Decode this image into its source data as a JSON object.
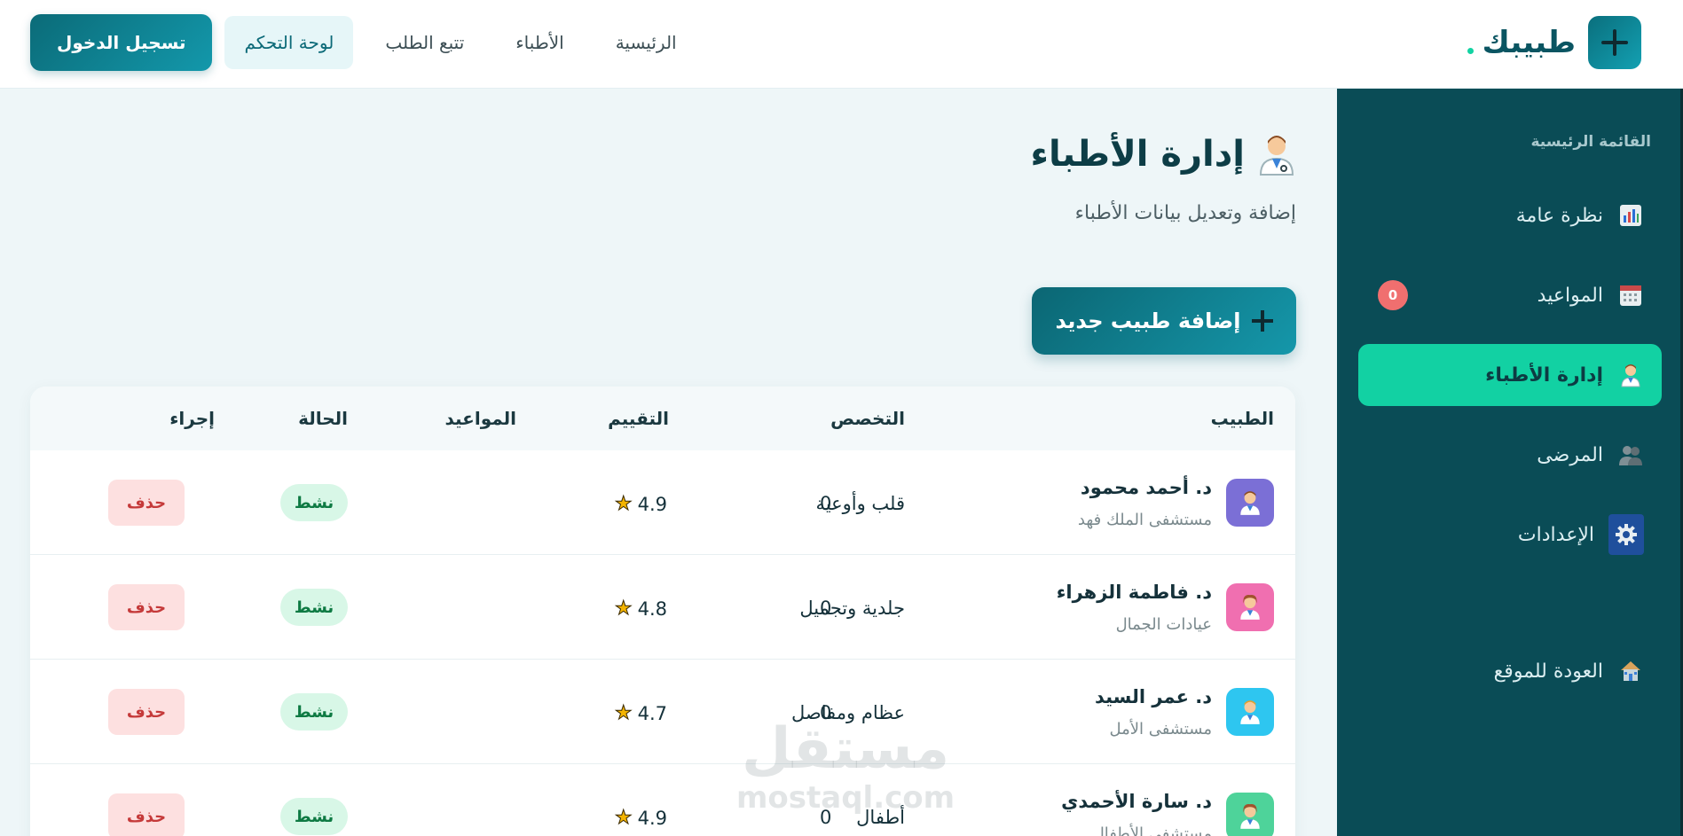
{
  "brand": {
    "name": "طبيبك"
  },
  "nav": {
    "home": "الرئيسية",
    "doctors": "الأطباء",
    "track": "تتبع الطلب",
    "dashboard": "لوحة التحكم",
    "login": "تسجيل الدخول"
  },
  "sidebar": {
    "heading": "القائمة الرئيسية",
    "items": [
      {
        "label": "نظرة عامة",
        "icon": "chart-icon"
      },
      {
        "label": "المواعيد",
        "icon": "calendar-icon",
        "badge": "0"
      },
      {
        "label": "إدارة الأطباء",
        "icon": "doctor-icon",
        "active": true
      },
      {
        "label": "المرضى",
        "icon": "patients-icon"
      },
      {
        "label": "الإعدادات",
        "icon": "gear-icon"
      }
    ],
    "back": "العودة للموقع"
  },
  "page": {
    "title": "إدارة الأطباء",
    "subtitle": "إضافة وتعديل بيانات الأطباء",
    "add_button": "إضافة طبيب جديد"
  },
  "table": {
    "headers": {
      "doctor": "الطبيب",
      "specialty": "التخصص",
      "rating": "التقييم",
      "appointments": "المواعيد",
      "status": "الحالة",
      "action": "إجراء"
    },
    "rows": [
      {
        "name": "د. أحمد محمود",
        "hospital": "مستشفى الملك فهد",
        "specialty": "قلب وأوعية",
        "rating": "4.9",
        "appointments": "0",
        "status": "نشط",
        "action": "حذف",
        "avatar_color": "#7b6fd6"
      },
      {
        "name": "د. فاطمة الزهراء",
        "hospital": "عيادات الجمال",
        "specialty": "جلدية وتجميل",
        "rating": "4.8",
        "appointments": "0",
        "status": "نشط",
        "action": "حذف",
        "avatar_color": "#f06fb0"
      },
      {
        "name": "د. عمر السيد",
        "hospital": "مستشفى الأمل",
        "specialty": "عظام ومفاصل",
        "rating": "4.7",
        "appointments": "0",
        "status": "نشط",
        "action": "حذف",
        "avatar_color": "#2ec6f0"
      },
      {
        "name": "د. سارة الأحمدي",
        "hospital": "مستشفى الأطفال",
        "specialty": "أطفال",
        "rating": "4.9",
        "appointments": "0",
        "status": "نشط",
        "action": "حذف",
        "avatar_color": "#4ed39a"
      }
    ]
  },
  "watermark": {
    "ar": "مستقل",
    "en": "mostaql.com"
  },
  "colors": {
    "primary": "#0b6b78",
    "sidebar": "#0a4c56",
    "active": "#12d1a3",
    "badge": "#f06f6f"
  }
}
